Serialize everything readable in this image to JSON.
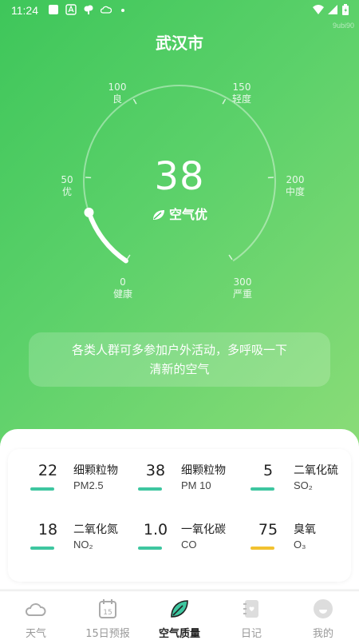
{
  "status_bar": {
    "time": "11:24"
  },
  "watermark": "9ubi90",
  "header": {
    "city": "武汉市"
  },
  "gauge": {
    "value": "38",
    "level": "空气优",
    "fill_fraction": 0.127,
    "ticks": [
      {
        "value": "0",
        "label": "健康"
      },
      {
        "value": "50",
        "label": "优"
      },
      {
        "value": "100",
        "label": "良"
      },
      {
        "value": "150",
        "label": "轻度"
      },
      {
        "value": "200",
        "label": "中度"
      },
      {
        "value": "300",
        "label": "严重"
      }
    ]
  },
  "advice": {
    "line1": "各类人群可多参加户外活动，多呼吸一下",
    "line2": "清新的空气"
  },
  "pollutants": [
    {
      "value": "22",
      "name": "细颗粒物",
      "code": "PM2.5",
      "bar_color": "#3ec6a0"
    },
    {
      "value": "38",
      "name": "细颗粒物",
      "code": "PM 10",
      "bar_color": "#3ec6a0"
    },
    {
      "value": "5",
      "name": "二氧化硫",
      "code": "SO₂",
      "bar_color": "#3ec6a0"
    },
    {
      "value": "18",
      "name": "二氧化氮",
      "code": "NO₂",
      "bar_color": "#3ec6a0"
    },
    {
      "value": "1.0",
      "name": "一氧化碳",
      "code": "CO",
      "bar_color": "#3ec6a0"
    },
    {
      "value": "75",
      "name": "臭氧",
      "code": "O₃",
      "bar_color": "#f2c230"
    }
  ],
  "nav": {
    "items": [
      {
        "label": "天气",
        "icon": "cloud-icon",
        "active": false
      },
      {
        "label": "15日预报",
        "icon": "calendar-icon",
        "active": false
      },
      {
        "label": "空气质量",
        "icon": "leaf-icon",
        "active": true
      },
      {
        "label": "日记",
        "icon": "diary-icon",
        "active": false
      },
      {
        "label": "我的",
        "icon": "profile-icon",
        "active": false
      }
    ]
  },
  "colors": {
    "brand_green": "#3ec65a",
    "good_bar": "#3ec6a0",
    "moderate_bar": "#f2c230"
  }
}
